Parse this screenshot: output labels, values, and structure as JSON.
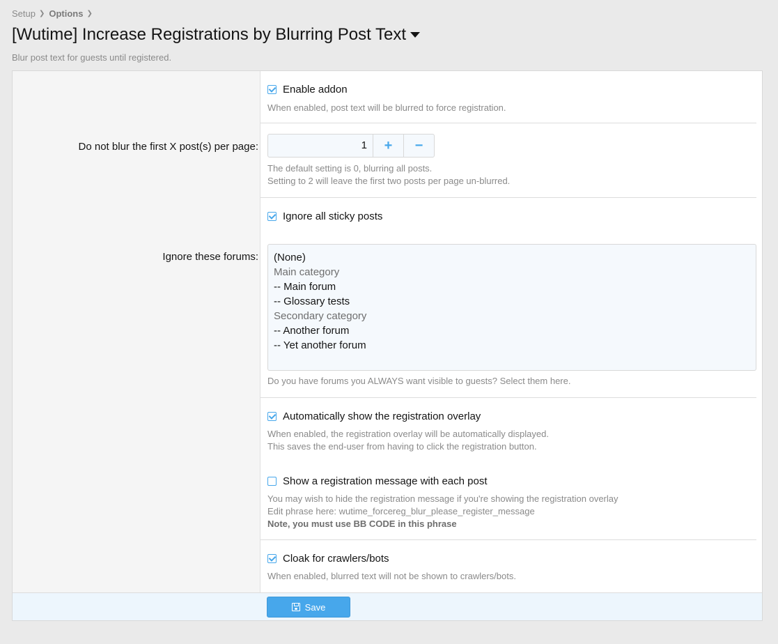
{
  "breadcrumb": {
    "items": [
      "Setup",
      "Options"
    ]
  },
  "header": {
    "title": "[Wutime] Increase Registrations by Blurring Post Text",
    "description": "Blur post text for guests until registered."
  },
  "options": {
    "enable_addon": {
      "label": "Enable addon",
      "checked": true,
      "hint": "When enabled, post text will be blurred to force registration."
    },
    "first_posts": {
      "label": "Do not blur the first X post(s) per page:",
      "value": "1",
      "increment": "+",
      "decrement": "−",
      "hint_1": "The default setting is 0, blurring all posts.",
      "hint_2": "Setting to 2 will leave the first two posts per page un-blurred."
    },
    "ignore_sticky": {
      "label": "Ignore all sticky posts",
      "checked": true
    },
    "ignore_forums": {
      "label": "Ignore these forums:",
      "options": [
        {
          "text": "(None)",
          "group": false
        },
        {
          "text": "Main category",
          "group": true
        },
        {
          "text": "-- Main forum",
          "group": false
        },
        {
          "text": "-- Glossary tests",
          "group": false
        },
        {
          "text": "Secondary category",
          "group": true
        },
        {
          "text": "-- Another forum",
          "group": false
        },
        {
          "text": "-- Yet another forum",
          "group": false
        }
      ],
      "hint": "Do you have forums you ALWAYS want visible to guests? Select them here."
    },
    "auto_overlay": {
      "label": "Automatically show the registration overlay",
      "checked": true,
      "hint_1": "When enabled, the registration overlay will be automatically displayed.",
      "hint_2": "This saves the end-user from having to click the registration button."
    },
    "reg_message": {
      "label": "Show a registration message with each post",
      "checked": false,
      "hint_1": "You may wish to hide the registration message if you're showing the registration overlay",
      "hint_2": "Edit phrase here: wutime_forcereg_blur_please_register_message",
      "hint_3": "Note, you must use BB CODE in this phrase"
    },
    "cloak": {
      "label": "Cloak for crawlers/bots",
      "checked": true,
      "hint": "When enabled, blurred text will not be shown to crawlers/bots."
    }
  },
  "footer": {
    "save_label": "Save"
  },
  "colors": {
    "accent": "#47a7eb",
    "background": "#eaeaea",
    "muted_text": "#8a8a8a"
  }
}
